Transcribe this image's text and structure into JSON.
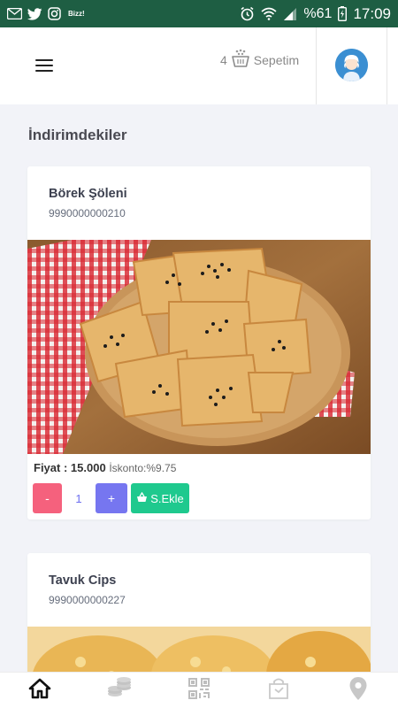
{
  "statusbar": {
    "carrier_text": "Bizz!",
    "battery": "%61",
    "time": "17:09"
  },
  "header": {
    "cart_count": "4",
    "cart_label": "Sepetim"
  },
  "section_title": "İndirimdekiler",
  "products": [
    {
      "name": "Börek Şöleni",
      "code": "9990000000210",
      "price_label": "Fiyat :",
      "price": "15.000",
      "discount_label": "İskonto:",
      "discount": "%9.75",
      "minus_label": "-",
      "quantity": "1",
      "plus_label": "+",
      "add_label": "S.Ekle"
    },
    {
      "name": "Tavuk Cips",
      "code": "9990000000227"
    }
  ],
  "bottom_nav": [
    "home-icon",
    "coins-icon",
    "qr-code-icon",
    "shopping-bag-icon",
    "location-pin-icon"
  ],
  "colors": {
    "statusbar": "#1e5e43",
    "minus_button": "#f5617d",
    "plus_button": "#7676f0",
    "add_button": "#1fc98e"
  }
}
